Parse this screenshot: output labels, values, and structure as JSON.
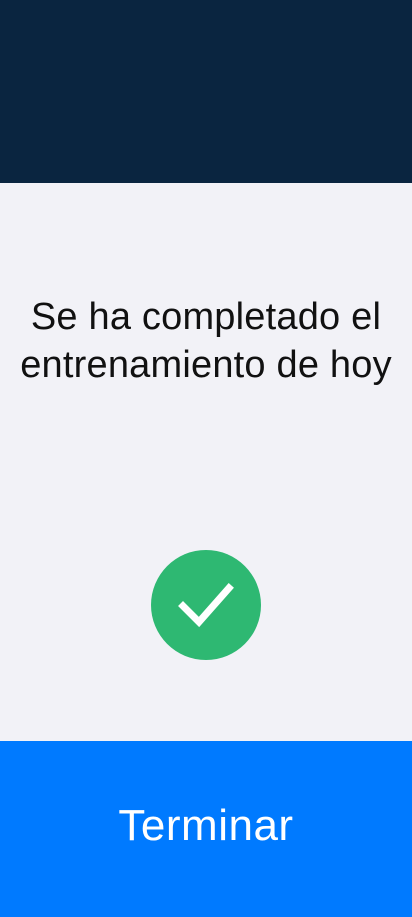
{
  "header": {
    "color": "#0a2540"
  },
  "completion": {
    "message": "Se ha completado el entrenamiento de hoy",
    "icon": "check-circle-icon",
    "icon_color": "#2eb872"
  },
  "footer": {
    "finish_label": "Terminar",
    "button_color": "#007aff"
  }
}
